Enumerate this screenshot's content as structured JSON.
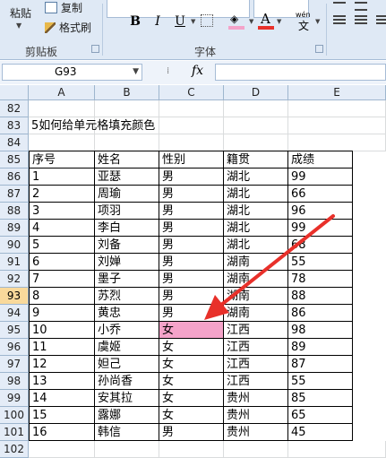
{
  "ribbon": {
    "paste_label": "粘贴",
    "copy_label": "复制",
    "format_painter_label": "格式刷",
    "clipboard_group": "剪贴板",
    "font_group": "字体",
    "bold": "B",
    "italic": "I",
    "underline": "U",
    "wen_label": "wén"
  },
  "formula_bar": {
    "name_box": "G93",
    "fx_label": "fx",
    "formula": ""
  },
  "columns": [
    "A",
    "B",
    "C",
    "D",
    "E"
  ],
  "rows": [
    {
      "num": "82",
      "cells": [
        "",
        "",
        "",
        "",
        ""
      ]
    },
    {
      "num": "83",
      "cells": [
        "5如何给单元格填充颜色",
        "",
        "",
        "",
        ""
      ]
    },
    {
      "num": "84",
      "cells": [
        "",
        "",
        "",
        "",
        ""
      ]
    },
    {
      "num": "85",
      "cells": [
        "序号",
        "姓名",
        "性别",
        "籍贯",
        "成绩"
      ]
    },
    {
      "num": "86",
      "cells": [
        "1",
        "亚瑟",
        "男",
        "湖北",
        "99"
      ]
    },
    {
      "num": "87",
      "cells": [
        "2",
        "周瑜",
        "男",
        "湖北",
        "66"
      ]
    },
    {
      "num": "88",
      "cells": [
        "3",
        "项羽",
        "男",
        "湖北",
        "96"
      ]
    },
    {
      "num": "89",
      "cells": [
        "4",
        "李白",
        "男",
        "湖北",
        "99"
      ]
    },
    {
      "num": "90",
      "cells": [
        "5",
        "刘备",
        "男",
        "湖北",
        "68"
      ]
    },
    {
      "num": "91",
      "cells": [
        "6",
        "刘婵",
        "男",
        "湖南",
        "55"
      ]
    },
    {
      "num": "92",
      "cells": [
        "7",
        "墨子",
        "男",
        "湖南",
        "78"
      ]
    },
    {
      "num": "93",
      "cells": [
        "8",
        "苏烈",
        "男",
        "湖南",
        "88"
      ]
    },
    {
      "num": "94",
      "cells": [
        "9",
        "黄忠",
        "男",
        "湖南",
        "86"
      ]
    },
    {
      "num": "95",
      "cells": [
        "10",
        "小乔",
        "女",
        "江西",
        "98"
      ]
    },
    {
      "num": "96",
      "cells": [
        "11",
        "虞姬",
        "女",
        "江西",
        "89"
      ]
    },
    {
      "num": "97",
      "cells": [
        "12",
        "妲己",
        "女",
        "江西",
        "87"
      ]
    },
    {
      "num": "98",
      "cells": [
        "13",
        "孙尚香",
        "女",
        "江西",
        "55"
      ]
    },
    {
      "num": "99",
      "cells": [
        "14",
        "安其拉",
        "女",
        "贵州",
        "85"
      ]
    },
    {
      "num": "100",
      "cells": [
        "15",
        "露娜",
        "女",
        "贵州",
        "65"
      ]
    },
    {
      "num": "101",
      "cells": [
        "16",
        "韩信",
        "男",
        "贵州",
        "45"
      ]
    },
    {
      "num": "102",
      "cells": [
        "",
        "",
        "",
        "",
        ""
      ]
    }
  ],
  "selected_row": "93",
  "highlighted_cell": {
    "row": "95",
    "col": "C"
  },
  "colors": {
    "highlight_fill": "#f4a3c9",
    "arrow": "#e8302a",
    "font_color_bar": "#e8302a",
    "fill_color_bar": "#f4a3c9"
  }
}
